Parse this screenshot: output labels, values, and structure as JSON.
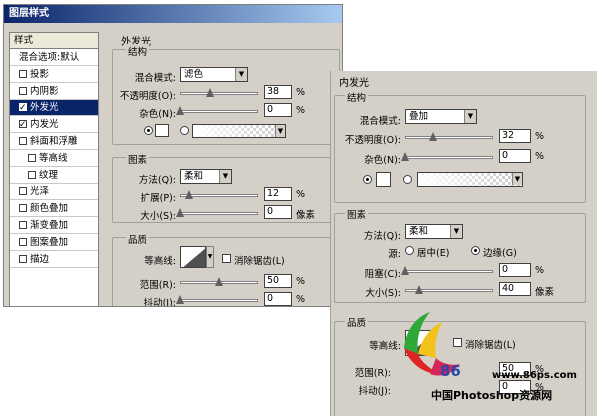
{
  "window1": {
    "title": "图层样式",
    "style_list": {
      "header": "样式",
      "items": [
        {
          "label": "混合选项:默认",
          "checkbox": false,
          "checked": false,
          "selected": false,
          "indent": false
        },
        {
          "label": "投影",
          "checkbox": true,
          "checked": false,
          "selected": false,
          "indent": false
        },
        {
          "label": "内阴影",
          "checkbox": true,
          "checked": false,
          "selected": false,
          "indent": false
        },
        {
          "label": "外发光",
          "checkbox": true,
          "checked": true,
          "selected": true,
          "indent": false
        },
        {
          "label": "内发光",
          "checkbox": true,
          "checked": true,
          "selected": false,
          "indent": false
        },
        {
          "label": "斜面和浮雕",
          "checkbox": true,
          "checked": false,
          "selected": false,
          "indent": false
        },
        {
          "label": "等高线",
          "checkbox": true,
          "checked": false,
          "selected": false,
          "indent": true
        },
        {
          "label": "纹理",
          "checkbox": true,
          "checked": false,
          "selected": false,
          "indent": true
        },
        {
          "label": "光泽",
          "checkbox": true,
          "checked": false,
          "selected": false,
          "indent": false
        },
        {
          "label": "颜色叠加",
          "checkbox": true,
          "checked": false,
          "selected": false,
          "indent": false
        },
        {
          "label": "渐变叠加",
          "checkbox": true,
          "checked": false,
          "selected": false,
          "indent": false
        },
        {
          "label": "图案叠加",
          "checkbox": true,
          "checked": false,
          "selected": false,
          "indent": false
        },
        {
          "label": "描边",
          "checkbox": true,
          "checked": false,
          "selected": false,
          "indent": false
        }
      ]
    },
    "panel_title": "外发光",
    "structure": {
      "label": "结构",
      "blend_mode_label": "混合模式:",
      "blend_mode_value": "滤色",
      "opacity_label": "不透明度(O):",
      "opacity_value": "38",
      "opacity_fraction": 0.38,
      "noise_label": "杂色(N):",
      "noise_value": "0",
      "noise_fraction": 0,
      "percent": "%"
    },
    "elements": {
      "label": "图素",
      "method_label": "方法(Q):",
      "method_value": "柔和",
      "spread_label": "扩展(P):",
      "spread_value": "12",
      "spread_fraction": 0.12,
      "size_label": "大小(S):",
      "size_value": "0",
      "size_fraction": 0,
      "percent": "%",
      "pixels": "像素"
    },
    "quality": {
      "label": "品质",
      "contour_label": "等高线:",
      "anti_alias_label": "消除锯齿(L)",
      "range_label": "范围(R):",
      "range_value": "50",
      "range_fraction": 0.5,
      "jitter_label": "抖动(J):",
      "jitter_value": "0",
      "jitter_fraction": 0,
      "percent": "%"
    }
  },
  "window2": {
    "panel_title": "内发光",
    "structure": {
      "label": "结构",
      "blend_mode_label": "混合模式:",
      "blend_mode_value": "叠加",
      "opacity_label": "不透明度(O):",
      "opacity_value": "32",
      "opacity_fraction": 0.32,
      "noise_label": "杂色(N):",
      "noise_value": "0",
      "noise_fraction": 0,
      "percent": "%"
    },
    "elements": {
      "label": "图素",
      "method_label": "方法(Q):",
      "method_value": "柔和",
      "source_label": "源:",
      "center_label": "居中(E)",
      "edge_label": "边缘(G)",
      "selected_source": "边缘(G)",
      "choke_label": "阻塞(C):",
      "choke_value": "0",
      "choke_fraction": 0,
      "size_label": "大小(S):",
      "size_value": "40",
      "size_fraction": 0.16,
      "percent": "%",
      "pixels": "像素"
    },
    "quality": {
      "label": "品质",
      "contour_label": "等高线:",
      "anti_alias_label": "消除锯齿(L)",
      "range_label": "范围(R):",
      "range_value": "50",
      "jitter_label": "抖动(J):",
      "jitter_value": "0",
      "percent": "%"
    }
  },
  "watermark": {
    "brand_number": "86",
    "url": "www.86ps.com",
    "site_name": "中国Photoshop资源网"
  },
  "colors": {
    "dialog_bg": "#d4d0c8",
    "selection": "#0a246a",
    "watermark_blue": "#2a47a8"
  }
}
